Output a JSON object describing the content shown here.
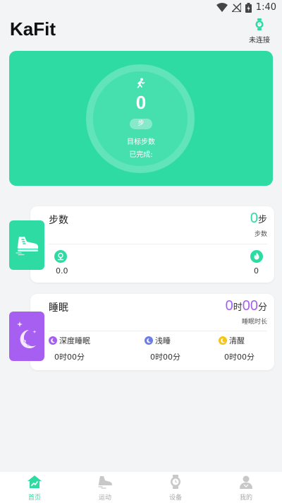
{
  "status_bar": {
    "time": "1:40"
  },
  "header": {
    "title": "KaFit",
    "device_status": "未连接"
  },
  "hero": {
    "steps": "0",
    "unit": "步",
    "goal_label": "目标步数",
    "done_label": "已完成:"
  },
  "steps_card": {
    "title": "步数",
    "value": "0",
    "value_unit": "步",
    "sub_label": "步数",
    "distance_value": "0.0",
    "calorie_value": "0"
  },
  "sleep_card": {
    "title": "睡眠",
    "hours": "0",
    "hours_unit": "时",
    "minutes": "00",
    "minutes_unit": "分",
    "sub_label": "睡眠时长",
    "deep": {
      "label": "深度睡眠",
      "value": "0时00分"
    },
    "light": {
      "label": "浅睡",
      "value": "0时00分"
    },
    "awake": {
      "label": "清醒",
      "value": "0时00分"
    }
  },
  "tabbar": {
    "items": [
      {
        "label": "首页",
        "icon": "home-chart-icon"
      },
      {
        "label": "运动",
        "icon": "shoe-icon"
      },
      {
        "label": "设备",
        "icon": "watch-icon"
      },
      {
        "label": "我的",
        "icon": "person-icon"
      }
    ]
  },
  "colors": {
    "accent": "#2ddba3",
    "sleep": "#a65ff0",
    "light_sleep": "#6b7ee8",
    "awake": "#f5c518"
  }
}
